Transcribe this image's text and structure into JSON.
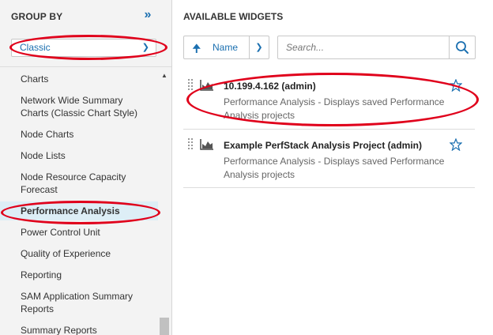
{
  "group_by": {
    "title": "GROUP BY",
    "selected": "Classic",
    "items": [
      "Charts",
      "Network Wide Summary Charts (Classic Chart Style)",
      "Node Charts",
      "Node Lists",
      "Node Resource Capacity Forecast",
      "Performance Analysis",
      "Power Control Unit",
      "Quality of Experience",
      "Reporting",
      "SAM Application Summary Reports",
      "Summary Reports"
    ],
    "active_item": "Performance Analysis"
  },
  "available_widgets": {
    "title": "AVAILABLE WIDGETS",
    "sort_label": "Name",
    "search_placeholder": "Search...",
    "widgets": [
      {
        "title": "10.199.4.162 (admin)",
        "description": "Performance Analysis - Displays saved Performance Analysis projects"
      },
      {
        "title": "Example PerfStack Analysis Project (admin)",
        "description": "Performance Analysis - Displays saved Performance Analysis projects"
      }
    ]
  },
  "icons": {
    "collapse": "double-chevron-right-icon",
    "dropdown": "chevron-down-icon",
    "sort": "arrow-up-icon",
    "search": "search-icon",
    "widget": "area-chart-icon",
    "drag": "drag-handle-icon",
    "favorite": "star-icon"
  },
  "colors": {
    "accent": "#1a6fb0",
    "annotation": "#e0001b",
    "active_bg": "#ddeef6"
  }
}
